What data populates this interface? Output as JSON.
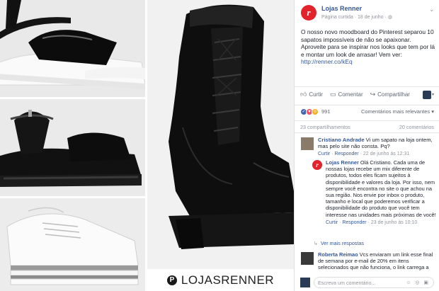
{
  "collage": {
    "watermark_text": "LOJASRENNER",
    "watermark_icon": "pinterest-icon",
    "photos": [
      {
        "name": "white-platform-sandal"
      },
      {
        "name": "black-platform-sandal"
      },
      {
        "name": "white-platform-sneaker"
      },
      {
        "name": "black-lace-up-boot"
      }
    ]
  },
  "post": {
    "page_name": "Lojas Renner",
    "page_logo_letter": "r",
    "meta": "Página curtida · 18 de junho ·",
    "text_1": "O nosso novo moodboard do Pinterest separou 10 sapatos impossíveis de não se apaixonar. Aproveite para se inspirar nos looks que tem por lá e montar um look de arrasar! Vem ver: ",
    "link": "http://renner.co/kEq",
    "actions": {
      "like": "Curtir",
      "comment": "Comentar",
      "share": "Compartilhar"
    },
    "reactions_count": "991",
    "sort_label": "Comentários mais relevantes",
    "shares": "23 compartilhamentos",
    "comments_count": "20 comentários"
  },
  "comments": [
    {
      "name": "Cristiano Andrade",
      "text": " Vi um sapato na loja ontem, mas pelo site não consta. Pq?",
      "like": "Curtir",
      "reply": "Responder",
      "time": "· 22 de junho às 12:31"
    }
  ],
  "reply": {
    "name": "Lojas Renner",
    "text": " Olá Cristiano. Cada uma de nossas lojas recebe um mix diferente de produtos, todos eles ficam sujeitos à disponibilidade e valores da loja. Por isso, nem sempre você encontra no site o que achou na sua região. Nos envie por inbox o produto, tamanho e local que poderemos verificar a disponibilidade do produto que você tem interesse nas unidades mais próximas de você!",
    "like": "Curtir",
    "reply": "Responder",
    "time": "· 23 de junho às 10:10"
  },
  "more_replies": "Ver mais respostas",
  "comment2": {
    "name": "Roberta Reimao",
    "text": " Vcs enviaram um link esse final de semana por e-mail de 20% em itens selecionados que não funciona, o link carrega a"
  },
  "write": {
    "placeholder": "Escreva um comentário...",
    "icons": "☺ ◎ ▣"
  },
  "colors": {
    "brand": "#e3232b",
    "link": "#365899",
    "like": "#4267b2"
  }
}
